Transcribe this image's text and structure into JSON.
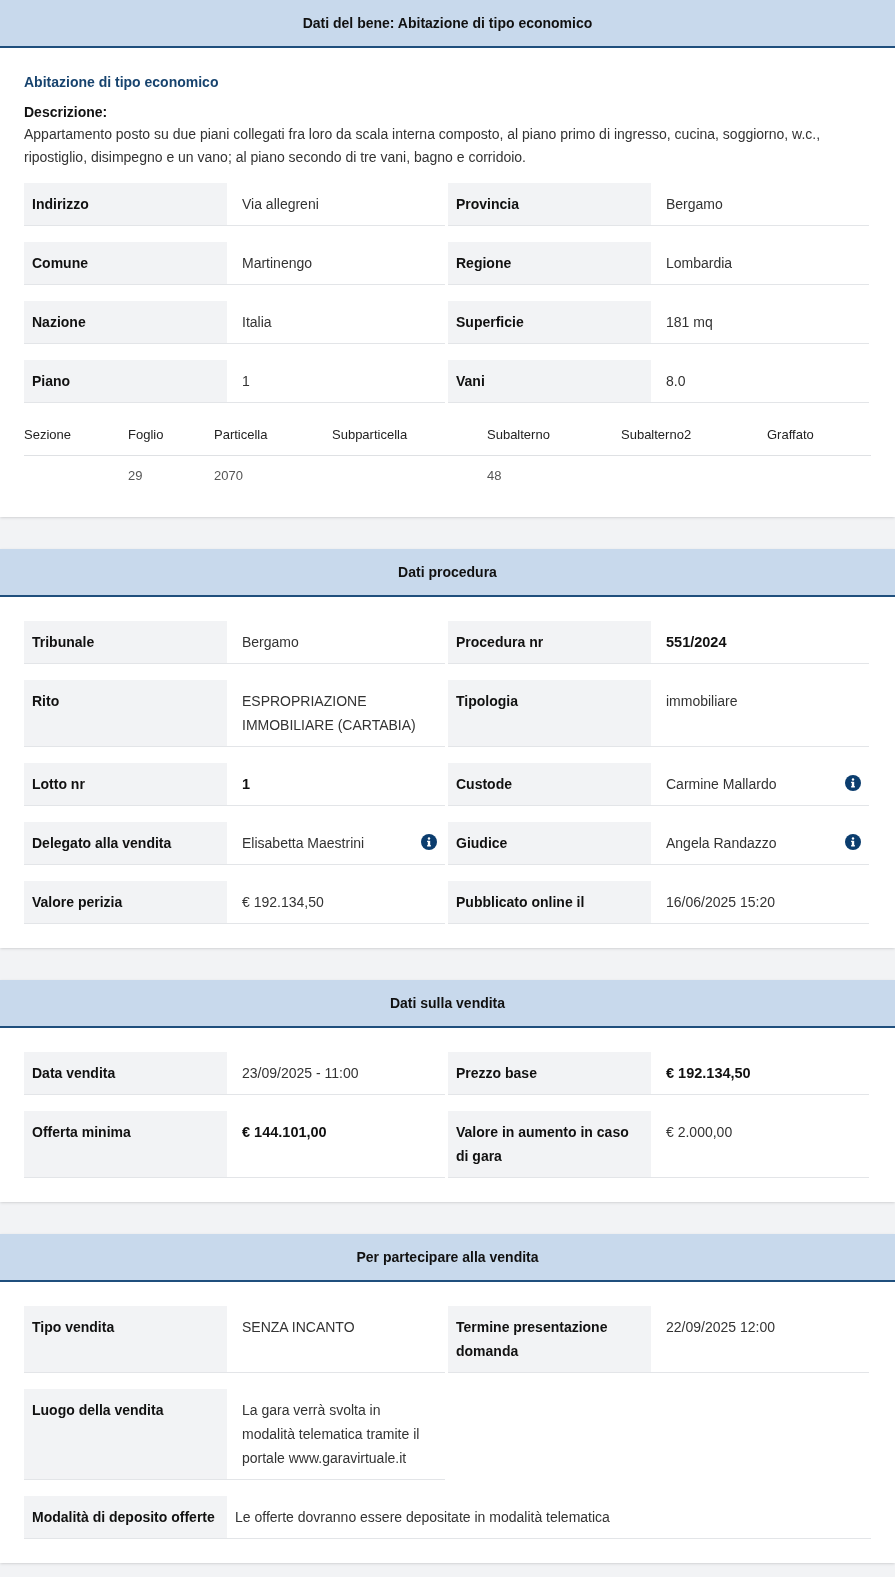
{
  "sections": [
    {
      "title": "Dati del bene: Abitazione di tipo economico",
      "subtitle": "Abitazione di tipo economico",
      "description_label": "Descrizione:",
      "description": "Appartamento posto su due piani collegati fra loro da scala interna composto, al piano primo di ingresso, cucina, soggiorno, w.c., ripostiglio, disimpegno e un vano; al piano secondo di tre vani, bagno e corridoio.",
      "rows": [
        {
          "kind": "pair",
          "fields": [
            {
              "label": "Indirizzo",
              "value": "Via allegreni",
              "bold": false
            },
            {
              "label": "Provincia",
              "value": "Bergamo",
              "bold": false
            }
          ]
        },
        {
          "kind": "pair",
          "fields": [
            {
              "label": "Comune",
              "value": "Martinengo",
              "bold": false
            },
            {
              "label": "Regione",
              "value": "Lombardia",
              "bold": false
            }
          ]
        },
        {
          "kind": "pair",
          "fields": [
            {
              "label": "Nazione",
              "value": "Italia",
              "bold": false
            },
            {
              "label": "Superficie",
              "value": "181 mq",
              "bold": false
            }
          ]
        },
        {
          "kind": "pair",
          "fields": [
            {
              "label": "Piano",
              "value": "1",
              "bold": false
            },
            {
              "label": "Vani",
              "value": "8.0",
              "bold": false
            }
          ]
        }
      ],
      "table": {
        "columns": [
          "Sezione",
          "Foglio",
          "Particella",
          "Subparticella",
          "Subalterno",
          "Subalterno2",
          "Graffato"
        ],
        "rows": [
          [
            "",
            "29",
            "2070",
            "",
            "48",
            "",
            ""
          ]
        ]
      }
    },
    {
      "title": "Dati procedura",
      "rows": [
        {
          "kind": "pair",
          "fields": [
            {
              "label": "Tribunale",
              "value": "Bergamo",
              "bold": false
            },
            {
              "label": "Procedura nr",
              "value": "551/2024",
              "bold": true
            }
          ]
        },
        {
          "kind": "pair",
          "fields": [
            {
              "label": "Rito",
              "value": "ESPROPRIAZIONE IMMOBILIARE (CARTABIA)",
              "bold": false
            },
            {
              "label": "Tipologia",
              "value": "immobiliare",
              "bold": false
            }
          ]
        },
        {
          "kind": "pair",
          "fields": [
            {
              "label": "Lotto nr",
              "value": "1",
              "bold": true
            },
            {
              "label": "Custode",
              "value": "Carmine Mallardo",
              "bold": false,
              "info": true
            }
          ]
        },
        {
          "kind": "pair",
          "fields": [
            {
              "label": "Delegato alla vendita",
              "value": "Elisabetta Maestrini",
              "bold": false,
              "info": true
            },
            {
              "label": "Giudice",
              "value": "Angela Randazzo",
              "bold": false,
              "info": true
            }
          ]
        },
        {
          "kind": "pair",
          "fields": [
            {
              "label": "Valore perizia",
              "value": "€ 192.134,50",
              "bold": false
            },
            {
              "label": "Pubblicato online il",
              "value": "16/06/2025 15:20",
              "bold": false
            }
          ]
        }
      ]
    },
    {
      "title": "Dati sulla vendita",
      "rows": [
        {
          "kind": "pair",
          "fields": [
            {
              "label": "Data vendita",
              "value": "23/09/2025 - 11:00",
              "bold": false
            },
            {
              "label": "Prezzo base",
              "value": "€ 192.134,50",
              "bold": true
            }
          ]
        },
        {
          "kind": "pair",
          "fields": [
            {
              "label": "Offerta minima",
              "value": "€ 144.101,00",
              "bold": true
            },
            {
              "label": "Valore in aumento in caso di gara",
              "value": "€ 2.000,00",
              "bold": false
            }
          ]
        }
      ]
    },
    {
      "title": "Per partecipare alla vendita",
      "rows": [
        {
          "kind": "pair",
          "fields": [
            {
              "label": "Tipo vendita",
              "value": "SENZA INCANTO",
              "bold": false
            },
            {
              "label": "Termine presentazione domanda",
              "value": "22/09/2025 12:00",
              "bold": false
            }
          ]
        },
        {
          "kind": "pair",
          "fields": [
            {
              "label": "Luogo della vendita",
              "value": "La gara verrà svolta in modalità telematica tramite il portale www.garavirtuale.it",
              "bold": false
            }
          ]
        },
        {
          "kind": "wide",
          "fields": [
            {
              "label": "Modalità di deposito offerte",
              "value": "Le offerte dovranno essere depositate in modalità telematica",
              "bold": false
            }
          ]
        }
      ]
    }
  ]
}
